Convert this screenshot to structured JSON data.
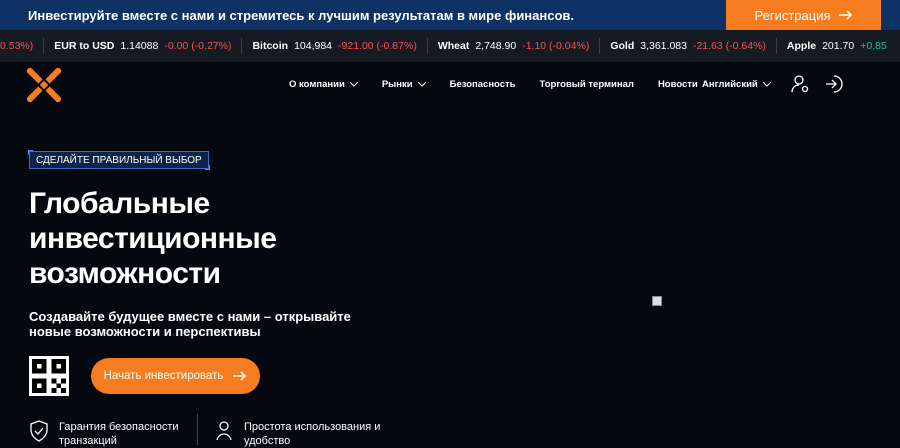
{
  "promo": {
    "text": "Инвестируйте вместе с нами и стремитесь к лучшим результатам в мире финансов.",
    "button": "Регистрация"
  },
  "ticker": [
    {
      "name": "",
      "price": "",
      "change": "0.53%)",
      "dir": "dn"
    },
    {
      "name": "EUR to USD",
      "price": "1.14088",
      "change": "-0.00 (-0.27%)",
      "dir": "dn"
    },
    {
      "name": "Bitcoin",
      "price": "104,984",
      "change": "-921.00 (-0.87%)",
      "dir": "dn"
    },
    {
      "name": "Wheat",
      "price": "2,748.90",
      "change": "-1.10 (-0.04%)",
      "dir": "dn"
    },
    {
      "name": "Gold",
      "price": "3,361.083",
      "change": "-21.63 (-0.64%)",
      "dir": "dn"
    },
    {
      "name": "Apple",
      "price": "201.70",
      "change": "+0.85",
      "dir": "up"
    }
  ],
  "nav": {
    "items": [
      "О компании",
      "Рынки",
      "Безопасность",
      "Торговый терминал",
      "Новости"
    ],
    "language": "Английский"
  },
  "hero": {
    "badge": "СДЕЛАЙТЕ ПРАВИЛЬНЫЙ ВЫБОР",
    "title": "Глобальные инвестиционные возможности",
    "subtitle": "Создавайте будущее вместе с нами – открывайте новые возможности и перспективы",
    "cta": "Начать инвестировать"
  },
  "features": [
    "Гарантия безопасности транзакций",
    "Простота использования и удобство"
  ],
  "colors": {
    "accent": "#f57c1f",
    "promo_bg": "#0f3264"
  }
}
